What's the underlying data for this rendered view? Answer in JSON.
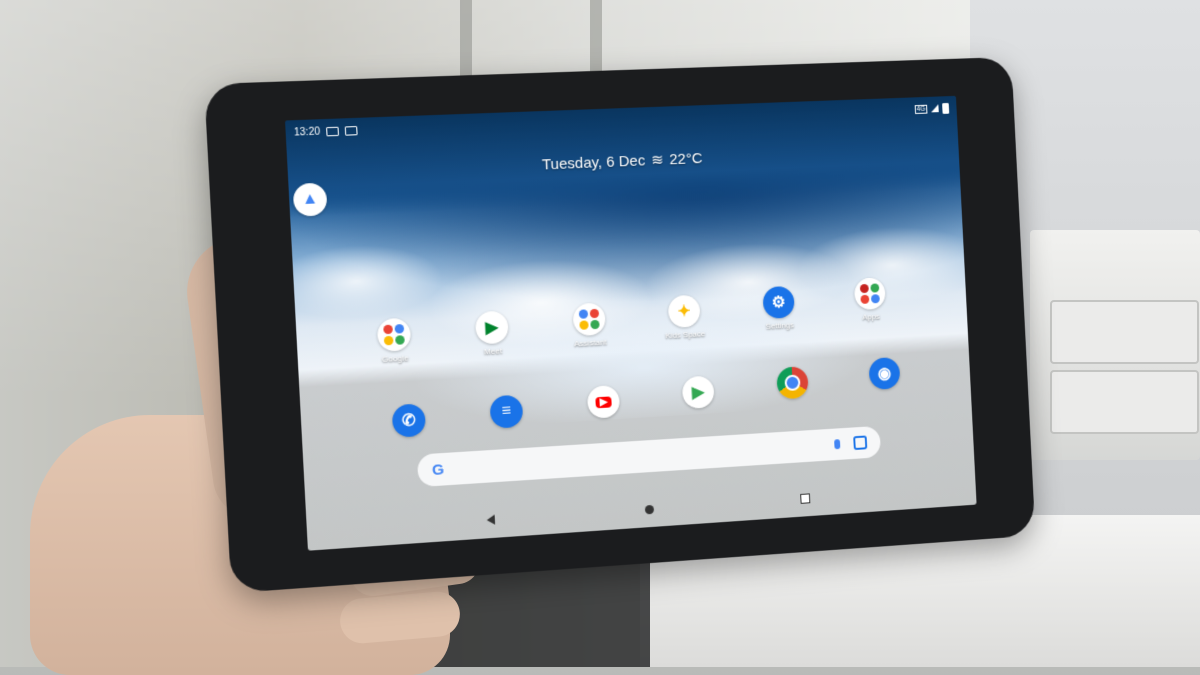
{
  "status_bar": {
    "time": "13:20",
    "network": "4G"
  },
  "glance": {
    "date": "Tuesday, 6 Dec",
    "weather_icon": "≋",
    "temperature": "22°C"
  },
  "home_apps": [
    {
      "label": "Google",
      "icon": "folder-icon"
    },
    {
      "label": "Meet",
      "icon": "meet-icon"
    },
    {
      "label": "Assistant",
      "icon": "assistant-icon"
    },
    {
      "label": "Kids Space",
      "icon": "kids-space-icon"
    },
    {
      "label": "Settings",
      "icon": "settings-icon"
    },
    {
      "label": "Apps",
      "icon": "apps-folder-icon"
    }
  ],
  "dock_apps": [
    {
      "name": "phone",
      "icon": "phone-icon",
      "color": "#1a73e8"
    },
    {
      "name": "messages",
      "icon": "messages-icon",
      "color": "#1a73e8"
    },
    {
      "name": "youtube",
      "icon": "youtube-icon",
      "color": "#ff0000"
    },
    {
      "name": "play",
      "icon": "play-store-icon",
      "color": "#34a853"
    },
    {
      "name": "chrome",
      "icon": "chrome-icon",
      "color": "#db4437"
    },
    {
      "name": "camera",
      "icon": "camera-icon",
      "color": "#1a73e8"
    }
  ],
  "search": {
    "logo": "G"
  },
  "colors": {
    "google_blue": "#4285f4",
    "google_red": "#ea4335",
    "google_yellow": "#fbbc05",
    "google_green": "#34a853"
  }
}
